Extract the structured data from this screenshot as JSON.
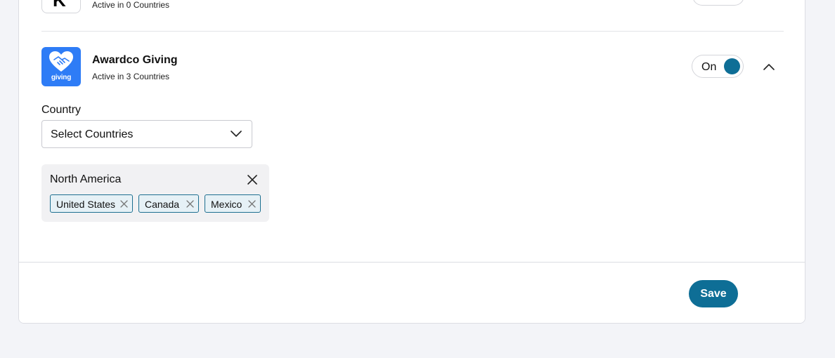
{
  "previous_app": {
    "logo_letter": "K",
    "status": "Active in 0 Countries"
  },
  "app": {
    "name": "Awardco Giving",
    "logo_text": "giving",
    "status": "Active in 3 Countries",
    "toggle_label": "On",
    "toggle_color": "#0e6e96",
    "logo_color": "#2e7cf6"
  },
  "country": {
    "label": "Country",
    "select_placeholder": "Select Countries"
  },
  "region": {
    "name": "North America",
    "countries": [
      "United States",
      "Canada",
      "Mexico"
    ]
  },
  "footer": {
    "save_label": "Save"
  }
}
